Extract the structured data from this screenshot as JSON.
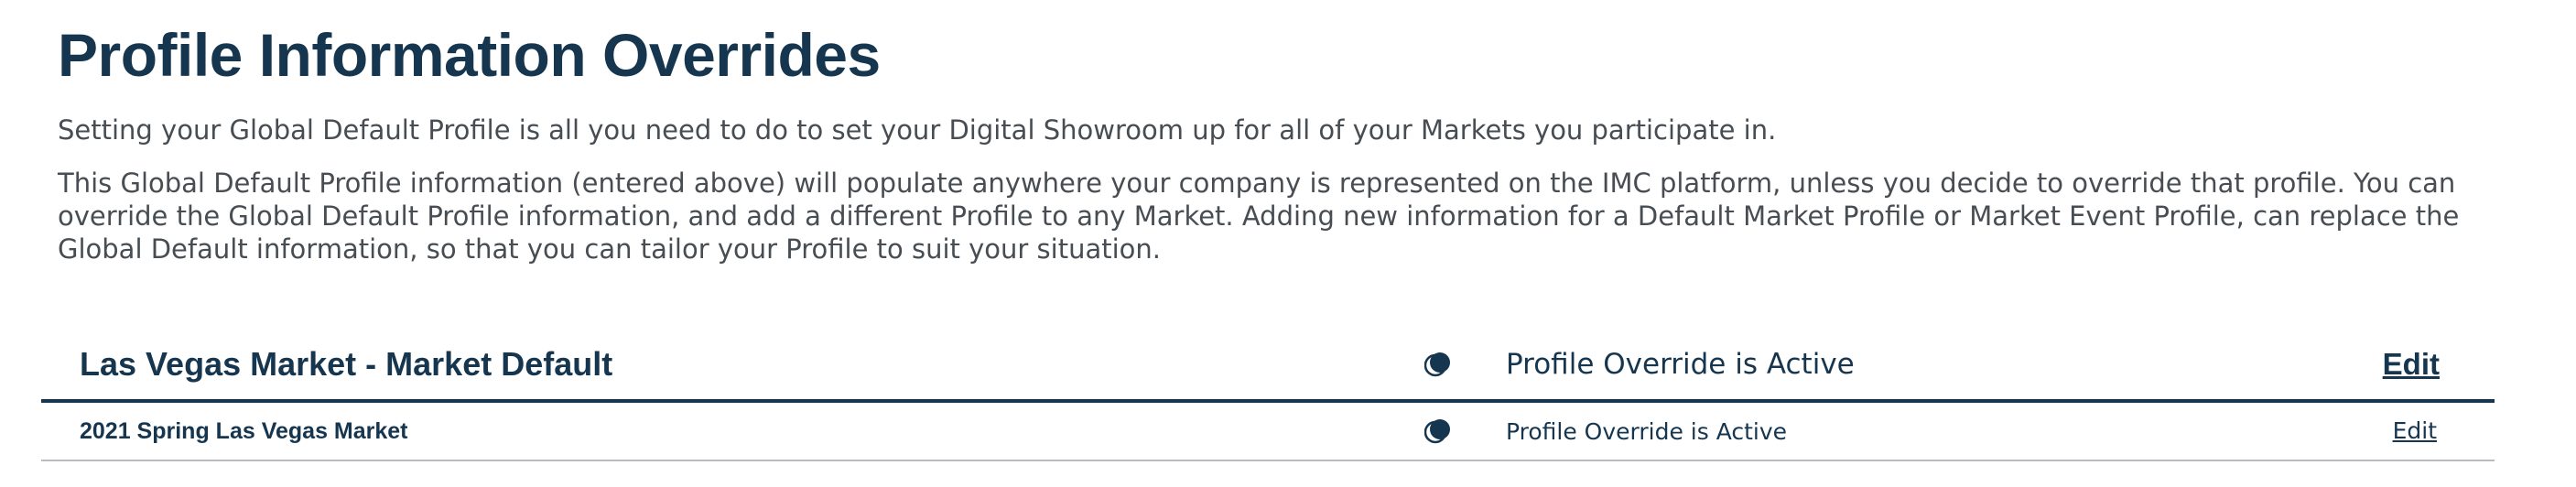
{
  "page": {
    "title": "Profile Information Overrides",
    "intro_1": "Setting your Global Default Profile is all you need to do to set your Digital Showroom up for all of your Markets you participate in.",
    "intro_2": "This Global Default Profile information (entered above) will populate anywhere your company is represented on the IMC platform, unless you decide to override that profile. You can override the Global Default Profile information, and add a different Profile to any Market. Adding new information for a Default Market Profile or Market Event Profile, can replace the Global Default information, so that you can tailor your Profile to suit your situation."
  },
  "overrides": {
    "market": {
      "name": "Las Vegas Market - Market Default",
      "status_icon": "override-active-icon",
      "status": "Profile Override is Active",
      "edit_label": "Edit"
    },
    "event": {
      "name": "2021 Spring Las Vegas Market",
      "status_icon": "override-active-icon",
      "status": "Profile Override is Active",
      "edit_label": "Edit"
    }
  },
  "colors": {
    "primary": "#163650",
    "body_text": "#474d52",
    "divider_light": "#b8bcc0"
  }
}
